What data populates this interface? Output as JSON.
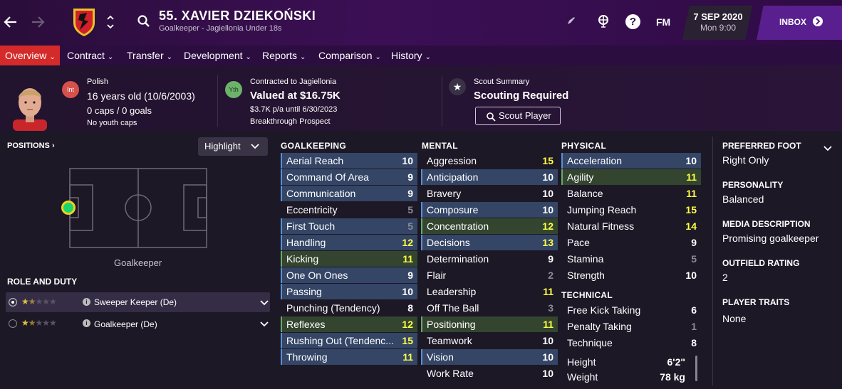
{
  "header": {
    "player_title": "55. XAVIER DZIEKOŃSKI",
    "player_subtitle": "Goalkeeper - Jagiellonia Under 18s",
    "fm_label": "FM",
    "date": "7 SEP 2020",
    "time": "Mon 9:00",
    "inbox_label": "INBOX",
    "colors": {
      "inbox": "#5a1f8e",
      "accent": "#d42a2a"
    }
  },
  "nav": {
    "tabs": [
      "Overview",
      "Contract",
      "Transfer",
      "Development",
      "Reports",
      "Comparison",
      "History"
    ]
  },
  "profile": {
    "nationality_badge": "Int",
    "nationality": "Polish",
    "age": "16 years old (10/6/2003)",
    "caps": "0 caps / 0 goals",
    "youth_caps": "No youth caps",
    "contract_badge": "Yth",
    "contract_text": "Contracted to Jagiellonia",
    "value": "Valued at $16.75K",
    "wage": "$3.7K p/a until 6/30/2023",
    "prospect": "Breakthrough Prospect",
    "scout_title": "Scout Summary",
    "scout_status": "Scouting Required",
    "scout_button": "Scout Player"
  },
  "positions": {
    "title": "POSITIONS",
    "highlight_label": "Highlight",
    "position_label": "Goalkeeper",
    "role_title": "ROLE AND DUTY",
    "roles": [
      {
        "name": "Sweeper Keeper (De)",
        "stars": 1.5
      },
      {
        "name": "Goalkeeper (De)",
        "stars": 1.5
      }
    ]
  },
  "goalkeeping": {
    "title": "GOALKEEPING",
    "rows": [
      {
        "name": "Aerial Reach",
        "val": "10"
      },
      {
        "name": "Command Of Area",
        "val": "9"
      },
      {
        "name": "Communication",
        "val": "9"
      },
      {
        "name": "Eccentricity",
        "val": "5"
      },
      {
        "name": "First Touch",
        "val": "5"
      },
      {
        "name": "Handling",
        "val": "12"
      },
      {
        "name": "Kicking",
        "val": "11"
      },
      {
        "name": "One On Ones",
        "val": "9"
      },
      {
        "name": "Passing",
        "val": "10"
      },
      {
        "name": "Punching (Tendency)",
        "val": "8"
      },
      {
        "name": "Reflexes",
        "val": "12"
      },
      {
        "name": "Rushing Out (Tendenc...",
        "val": "15"
      },
      {
        "name": "Throwing",
        "val": "11"
      }
    ]
  },
  "mental": {
    "title": "MENTAL",
    "rows": [
      {
        "name": "Aggression",
        "val": "15"
      },
      {
        "name": "Anticipation",
        "val": "10"
      },
      {
        "name": "Bravery",
        "val": "10"
      },
      {
        "name": "Composure",
        "val": "10"
      },
      {
        "name": "Concentration",
        "val": "12"
      },
      {
        "name": "Decisions",
        "val": "13"
      },
      {
        "name": "Determination",
        "val": "9"
      },
      {
        "name": "Flair",
        "val": "2"
      },
      {
        "name": "Leadership",
        "val": "11"
      },
      {
        "name": "Off The Ball",
        "val": "3"
      },
      {
        "name": "Positioning",
        "val": "11"
      },
      {
        "name": "Teamwork",
        "val": "10"
      },
      {
        "name": "Vision",
        "val": "10"
      },
      {
        "name": "Work Rate",
        "val": "10"
      }
    ]
  },
  "physical": {
    "title": "PHYSICAL",
    "rows": [
      {
        "name": "Acceleration",
        "val": "10"
      },
      {
        "name": "Agility",
        "val": "11"
      },
      {
        "name": "Balance",
        "val": "11"
      },
      {
        "name": "Jumping Reach",
        "val": "15"
      },
      {
        "name": "Natural Fitness",
        "val": "14"
      },
      {
        "name": "Pace",
        "val": "9"
      },
      {
        "name": "Stamina",
        "val": "5"
      },
      {
        "name": "Strength",
        "val": "10"
      }
    ]
  },
  "technical": {
    "title": "TECHNICAL",
    "rows": [
      {
        "name": "Free Kick Taking",
        "val": "6"
      },
      {
        "name": "Penalty Taking",
        "val": "1"
      },
      {
        "name": "Technique",
        "val": "8"
      }
    ]
  },
  "bio": {
    "height_label": "Height",
    "height": "6'2\"",
    "weight_label": "Weight",
    "weight": "78 kg"
  },
  "right_panel": {
    "foot_title": "PREFERRED FOOT",
    "foot": "Right Only",
    "personality_title": "PERSONALITY",
    "personality": "Balanced",
    "media_title": "MEDIA DESCRIPTION",
    "media": "Promising goalkeeper",
    "outfield_title": "OUTFIELD RATING",
    "outfield": "2",
    "traits_title": "PLAYER TRAITS",
    "traits": "None"
  }
}
